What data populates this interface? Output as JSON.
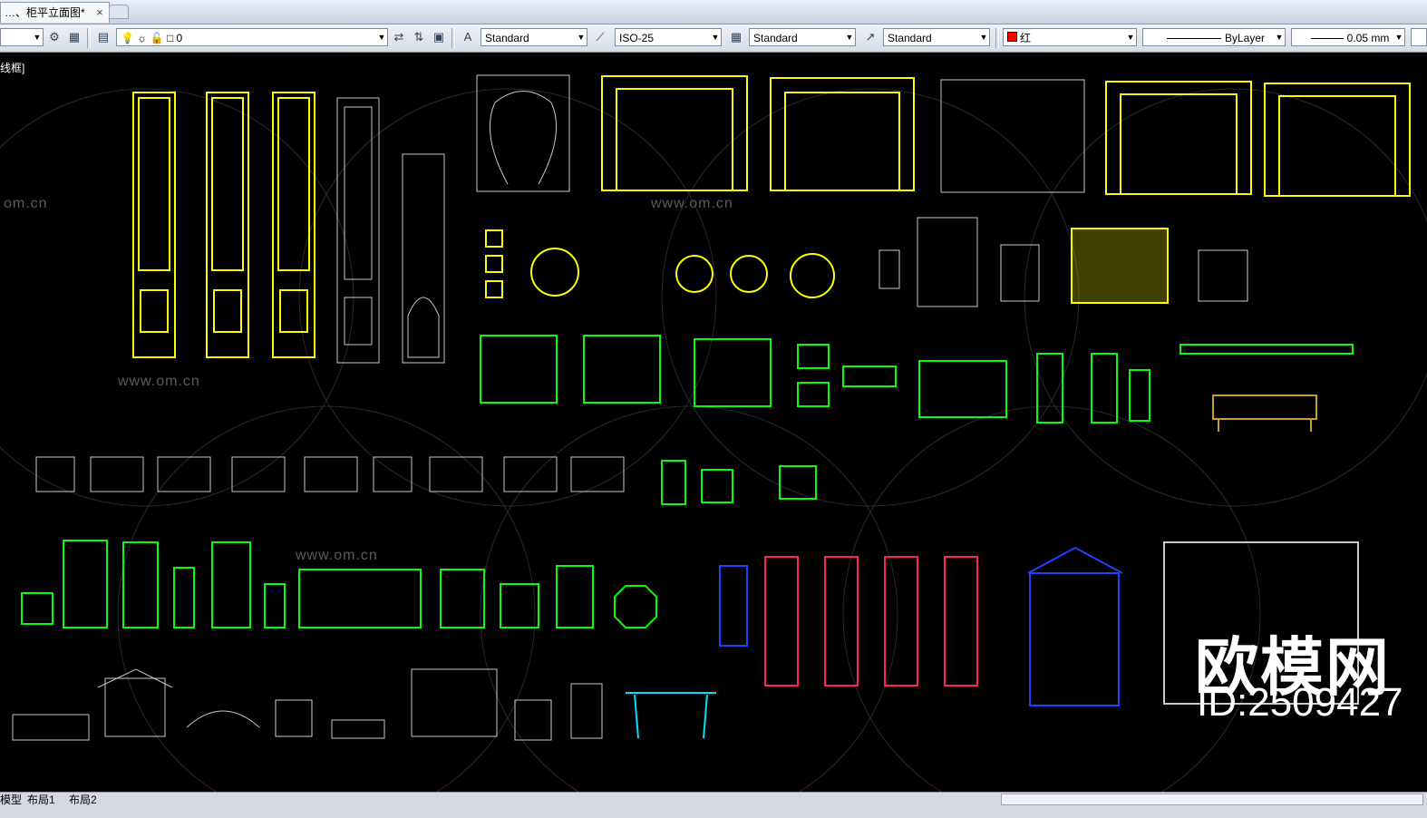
{
  "tab": {
    "title": "…、柜平立面图*",
    "close": "×"
  },
  "toolbar": {
    "text_style": "Standard",
    "dim_style": "ISO-25",
    "table_style": "Standard",
    "multileader_style": "Standard",
    "color": "红",
    "linetype": "ByLayer",
    "lineweight": "0.05 mm",
    "layer_value": "0"
  },
  "viewport_label": "线框]",
  "layout_tabs": [
    "模型",
    "布局1",
    "布局2"
  ],
  "watermark": {
    "brand": "欧模网",
    "url": "www.om.cn",
    "id_text": "ID:2509427",
    "url_fragment": "om.cn"
  },
  "colors": {
    "yellow": "#ffff00",
    "green": "#00ff00",
    "white": "#c8c8c8",
    "blue": "#2040ff",
    "cyan": "#00e0ff",
    "magenta": "#ff2060",
    "red": "#ff0000"
  }
}
